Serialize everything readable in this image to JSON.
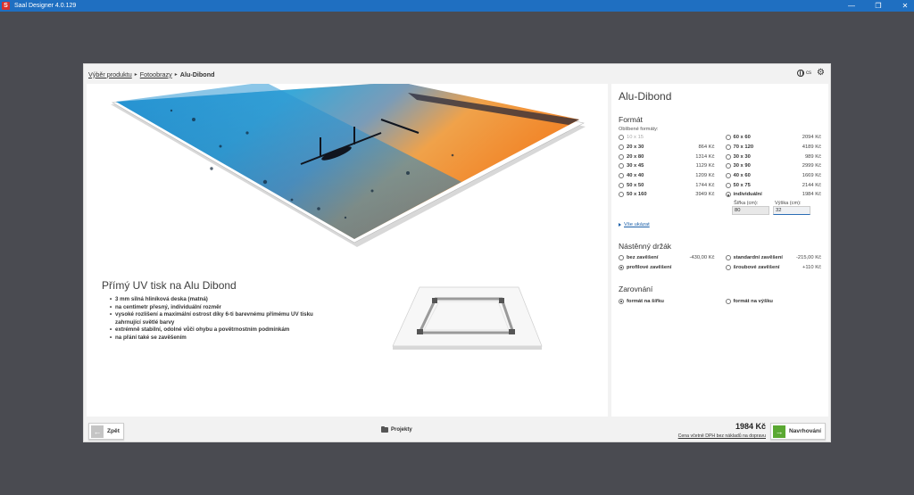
{
  "window": {
    "logo": "S",
    "title": "Saal Designer 4.0.129",
    "controls": [
      "—",
      "❐",
      "✕"
    ]
  },
  "breadcrumb": {
    "items": [
      "Výběr produktu",
      "Fotoobrazy",
      "Alu-Dibond"
    ]
  },
  "top_right": {
    "language": "cs",
    "globe_icon": "globe-icon",
    "settings_icon": "gear-icon"
  },
  "promo": {
    "title": "Přímý UV tisk na Alu Dibond",
    "bullets": [
      "3 mm silná hliníková deska (matná)",
      "na centimetr přesný, individuální rozměr",
      "vysoké rozlišení a maximální ostrost díky 6-ti barevnému přímému UV tisku zahrnující světlé barvy",
      "extrémně stabilní, odolné vůči ohybu a povětrnostním podmínkám",
      "na přání také se zavěšením"
    ]
  },
  "product": {
    "title": "Alu-Dibond",
    "format": {
      "heading": "Formát",
      "popular_label": "Oblíbené formáty:",
      "left": [
        {
          "size": "10 x 15",
          "price": "",
          "disabled": true,
          "checked": false
        },
        {
          "size": "20 x 30",
          "price": "864 Kč",
          "disabled": false,
          "checked": false
        },
        {
          "size": "20 x 80",
          "price": "1314 Kč",
          "disabled": false,
          "checked": false
        },
        {
          "size": "30 x 45",
          "price": "1129 Kč",
          "disabled": false,
          "checked": false
        },
        {
          "size": "40 x 40",
          "price": "1209 Kč",
          "disabled": false,
          "checked": false
        },
        {
          "size": "50 x 50",
          "price": "1744 Kč",
          "disabled": false,
          "checked": false
        },
        {
          "size": "50 x 160",
          "price": "3949 Kč",
          "disabled": false,
          "checked": false
        }
      ],
      "right": [
        {
          "size": "60 x 60",
          "price": "2094 Kč",
          "disabled": false,
          "checked": false
        },
        {
          "size": "70 x 120",
          "price": "4189 Kč",
          "disabled": false,
          "checked": false
        },
        {
          "size": "30 x 30",
          "price": "989 Kč",
          "disabled": false,
          "checked": false
        },
        {
          "size": "30 x 90",
          "price": "2999 Kč",
          "disabled": false,
          "checked": false
        },
        {
          "size": "40 x 60",
          "price": "1669 Kč",
          "disabled": false,
          "checked": false
        },
        {
          "size": "50 x 75",
          "price": "2144 Kč",
          "disabled": false,
          "checked": false
        },
        {
          "size": "individuální",
          "price": "1984 Kč",
          "disabled": false,
          "checked": true
        }
      ],
      "width_label": "Šířka (cm):",
      "width_value": "80",
      "height_label": "Výška (cm):",
      "height_value": "32",
      "show_all": "Vše ukázat"
    },
    "holder": {
      "heading": "Nástěnný držák",
      "options": [
        {
          "label": "bez zavěšení",
          "price": "-430,00 Kč",
          "checked": false
        },
        {
          "label": "standardní zavěšení",
          "price": "-215,00 Kč",
          "checked": false
        },
        {
          "label": "profilové zavěšení",
          "price": "",
          "checked": true
        },
        {
          "label": "šroubové zavěšení",
          "price": "+110 Kč",
          "checked": false
        }
      ]
    },
    "alignment": {
      "heading": "Zarovnání",
      "options": [
        {
          "label": "formát na šířku",
          "checked": true
        },
        {
          "label": "formát na výšku",
          "checked": false
        }
      ]
    }
  },
  "footer": {
    "back_label": "Zpět",
    "projects_label": "Projekty",
    "total": "1984 Kč",
    "price_note": "Cena včetně DPH bez nákladů na dopravu",
    "next_label": "Navrhování"
  },
  "colors": {
    "titlebar": "#1f6fc1",
    "back_arrow": "#c4c4c4",
    "next_arrow": "#5aa832",
    "link": "#1b5fa8"
  }
}
